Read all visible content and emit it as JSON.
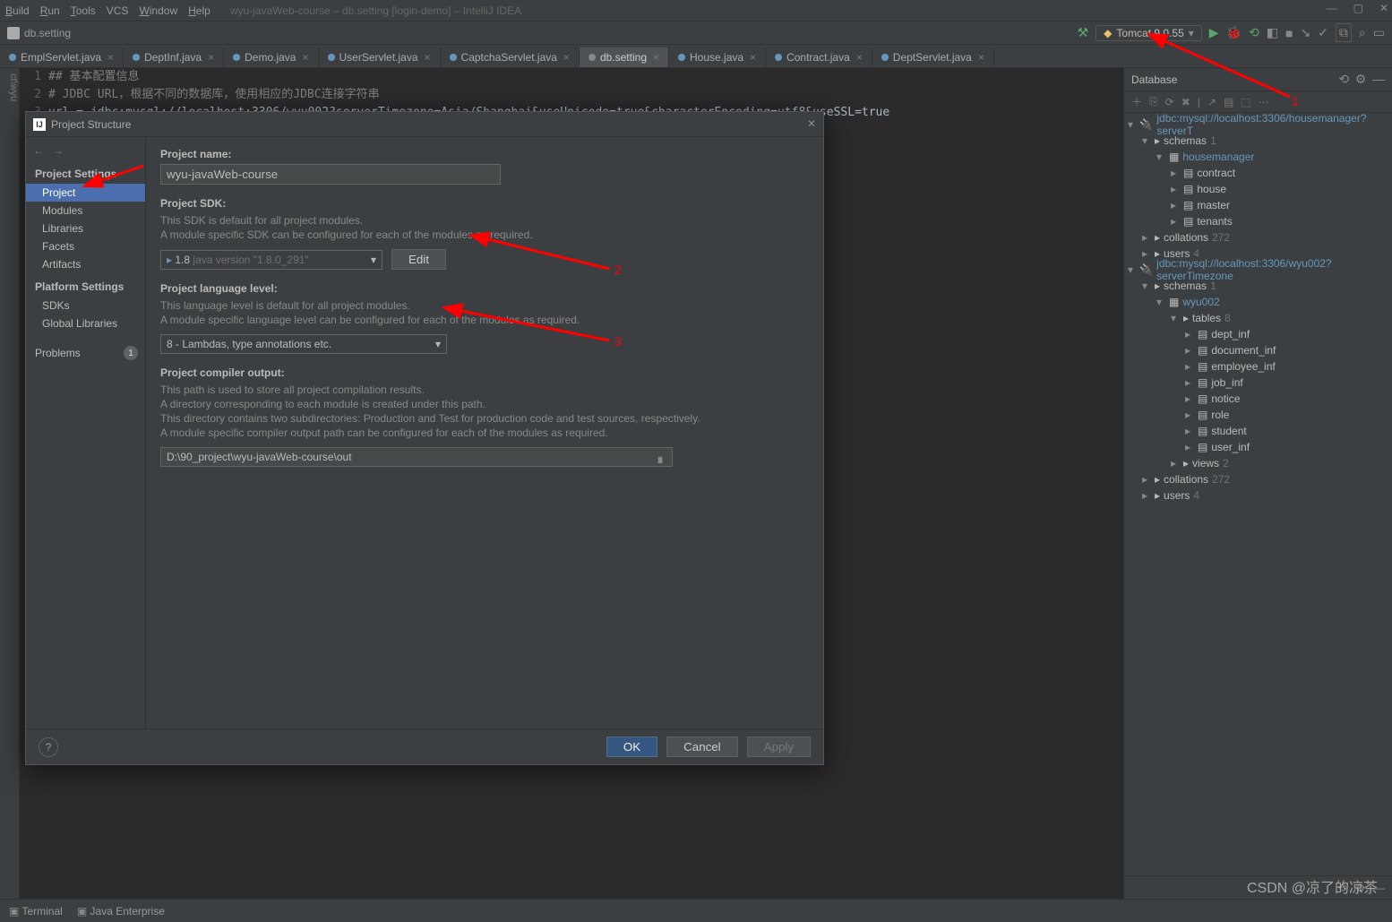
{
  "menu": {
    "items": [
      "Build",
      "Run",
      "Tools",
      "VCS",
      "Window",
      "Help"
    ],
    "underlines": [
      "B",
      "R",
      "T",
      "",
      "W",
      "H"
    ],
    "title": "wyu-javaWeb-course – db.setting [login-demo] – IntelliJ IDEA"
  },
  "nav": {
    "file": "db.setting",
    "run_config": "Tomcat 9.0.55"
  },
  "tabs": [
    {
      "label": "EmplServlet.java",
      "kind": "c"
    },
    {
      "label": "DeptInf.java",
      "kind": "c"
    },
    {
      "label": "Demo.java",
      "kind": "c"
    },
    {
      "label": "UserServlet.java",
      "kind": "c"
    },
    {
      "label": "CaptchaServlet.java",
      "kind": "c"
    },
    {
      "label": "db.setting",
      "kind": "s",
      "active": true
    },
    {
      "label": "House.java",
      "kind": "c"
    },
    {
      "label": "Contract.java",
      "kind": "c"
    },
    {
      "label": "DeptServlet.java",
      "kind": "c"
    }
  ],
  "code": {
    "lines": [
      {
        "n": "1",
        "text": "## 基本配置信息",
        "cls": "cmt"
      },
      {
        "n": "2",
        "text": "# JDBC URL，根据不同的数据库，使用相应的JDBC连接字符串",
        "cls": "cmt"
      },
      {
        "n": "3",
        "text": "url = jdbc:mysql://localhost:3306/wyu002?serverTimezone=Asia/Shanghai&useUnicode=true&characterEncoding=utf8&useSSL=true",
        "cls": ""
      }
    ]
  },
  "db": {
    "title": "Database",
    "ds": [
      {
        "name": "jdbc:mysql://localhost:3306/housemanager?serverT",
        "schemas": "schemas",
        "s_cnt": "1",
        "schema": "housemanager",
        "tables": [
          "contract",
          "house",
          "master",
          "tenants"
        ],
        "collations": "collations",
        "c_cnt": "272",
        "users": "users",
        "u_cnt": "4"
      },
      {
        "name": "jdbc:mysql://localhost:3306/wyu002?serverTimezone",
        "schemas": "schemas",
        "s_cnt": "1",
        "schema": "wyu002",
        "tables_lbl": "tables",
        "t_cnt": "8",
        "tables": [
          "dept_inf",
          "document_inf",
          "employee_inf",
          "job_inf",
          "notice",
          "role",
          "student",
          "user_inf"
        ],
        "views": "views",
        "v_cnt": "2",
        "collations": "collations",
        "c_cnt": "272",
        "users": "users",
        "u_cnt": "4"
      }
    ]
  },
  "dlg": {
    "title": "Project Structure",
    "side": {
      "head1": "Project Settings",
      "items1": [
        "Project",
        "Modules",
        "Libraries",
        "Facets",
        "Artifacts"
      ],
      "head2": "Platform Settings",
      "items2": [
        "SDKs",
        "Global Libraries"
      ],
      "problems": "Problems",
      "pcount": "1"
    },
    "main": {
      "pname_lbl": "Project name:",
      "pname": "wyu-javaWeb-course",
      "sdk_lbl": "Project SDK:",
      "sdk_d1": "This SDK is default for all project modules.",
      "sdk_d2": "A module specific SDK can be configured for each of the modules as required.",
      "sdk_val": "1.8",
      "sdk_hint": "java version \"1.8.0_291\"",
      "edit": "Edit",
      "lang_lbl": "Project language level:",
      "lang_d1": "This language level is default for all project modules.",
      "lang_d2": "A module specific language level can be configured for each of the modules as required.",
      "lang_val": "8 - Lambdas, type annotations etc.",
      "out_lbl": "Project compiler output:",
      "out_d1": "This path is used to store all project compilation results.",
      "out_d2": "A directory corresponding to each module is created under this path.",
      "out_d3": "This directory contains two subdirectories: Production and Test for production code and test sources, respectively.",
      "out_d4": "A module specific compiler output path can be configured for each of the modules as required.",
      "out_val": "D:\\90_project\\wyu-javaWeb-course\\out"
    },
    "foot": {
      "ok": "OK",
      "cancel": "Cancel",
      "apply": "Apply"
    }
  },
  "annot": {
    "a1": "1",
    "a2": "2",
    "a3": "3"
  },
  "status": {
    "terminal": "Terminal",
    "je": "Java Enterprise"
  },
  "watermark": "CSDN @凉了的凉茶"
}
